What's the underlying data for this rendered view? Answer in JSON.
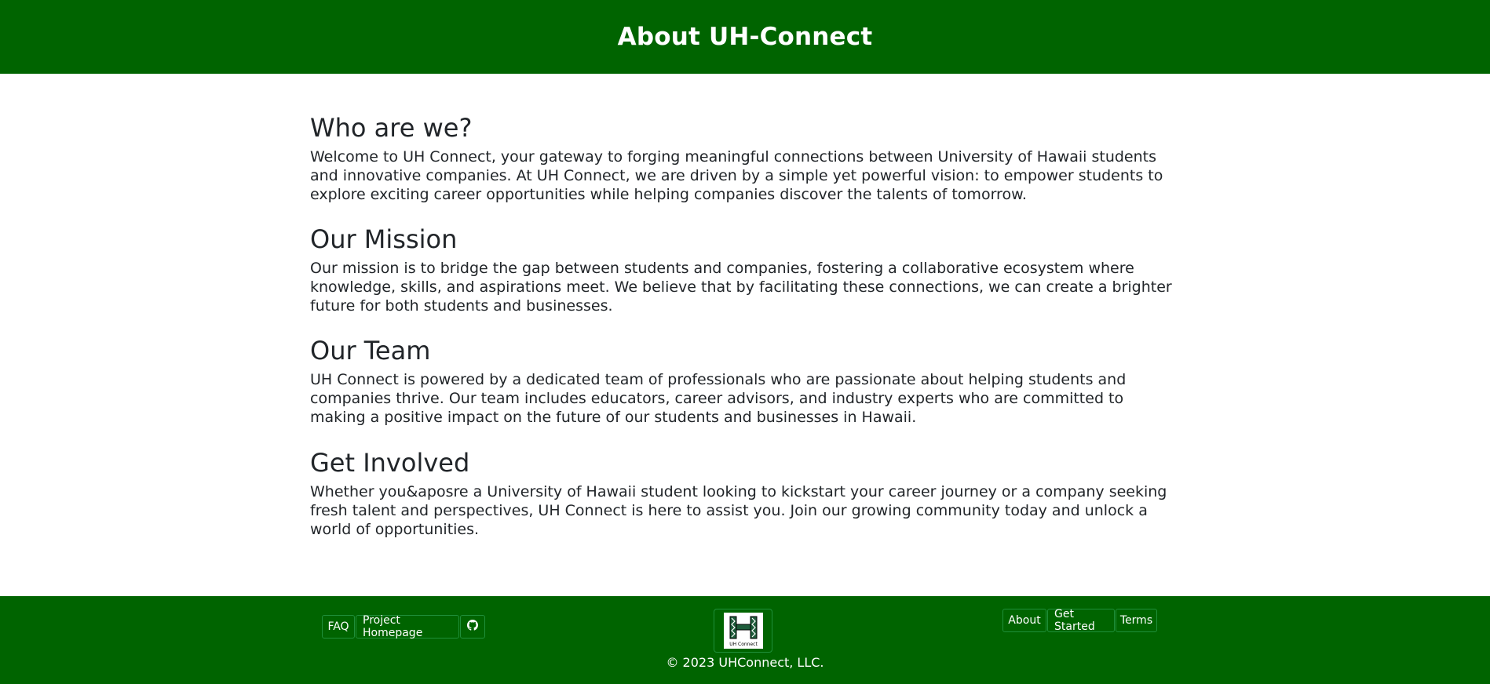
{
  "header": {
    "title": "About UH-Connect"
  },
  "sections": [
    {
      "heading": "Who are we?",
      "body": "Welcome to UH Connect, your gateway to forging meaningful connections between University of Hawaii students and innovative companies. At UH Connect, we are driven by a simple yet powerful vision: to empower students to explore exciting career opportunities while helping companies discover the talents of tomorrow."
    },
    {
      "heading": "Our Mission",
      "body": "Our mission is to bridge the gap between students and companies, fostering a collaborative ecosystem where knowledge, skills, and aspirations meet. We believe that by facilitating these connections, we can create a brighter future for both students and businesses."
    },
    {
      "heading": "Our Team",
      "body": "UH Connect is powered by a dedicated team of professionals who are passionate about helping students and companies thrive. Our team includes educators, career advisors, and industry experts who are committed to making a positive impact on the future of our students and businesses in Hawaii."
    },
    {
      "heading": "Get Involved",
      "body": "Whether you&aposre a University of Hawaii student looking to kickstart your career journey or a company seeking fresh talent and perspectives, UH Connect is here to assist you. Join our growing community today and unlock a world of opportunities."
    }
  ],
  "footer": {
    "left_links": {
      "faq": "FAQ",
      "project_homepage": "Project Homepage",
      "github_icon": "github-icon"
    },
    "logo": {
      "text": "UH Connect"
    },
    "right_links": {
      "about": "About",
      "get_started": "Get Started",
      "terms": "Terms"
    },
    "copyright": "© 2023 UHConnect, LLC."
  },
  "colors": {
    "brand_green": "#006400",
    "text": "#212529",
    "white": "#ffffff"
  }
}
